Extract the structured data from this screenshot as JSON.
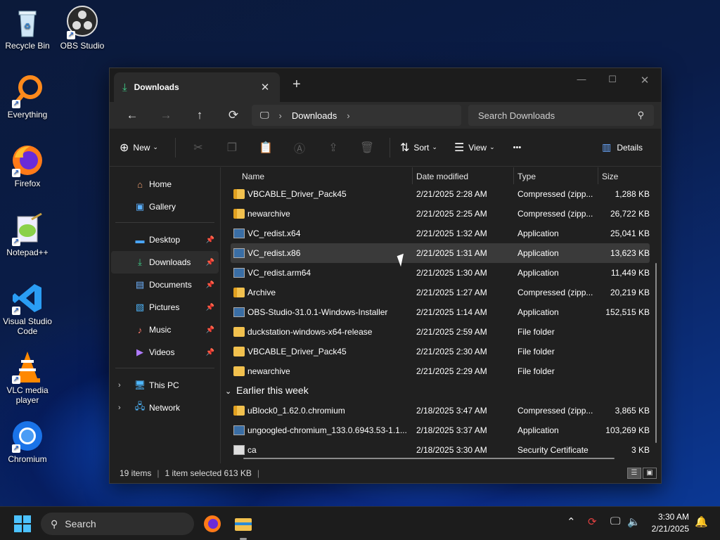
{
  "desktop": {
    "icons": [
      {
        "label": "Recycle Bin",
        "icon": "recycle-bin-icon"
      },
      {
        "label": "OBS Studio",
        "icon": "obs-icon"
      },
      {
        "label": "Everything",
        "icon": "everything-search-icon"
      },
      {
        "label": "Firefox",
        "icon": "firefox-icon"
      },
      {
        "label": "Notepad++",
        "icon": "notepad-plus-plus-icon"
      },
      {
        "label": "Visual Studio Code",
        "icon": "vscode-icon"
      },
      {
        "label": "VLC media player",
        "icon": "vlc-icon"
      },
      {
        "label": "Chromium",
        "icon": "chromium-icon"
      }
    ]
  },
  "window": {
    "tab_title": "Downloads",
    "tab_close": "✕",
    "new_tab": "+",
    "controls": {
      "minimize": "—",
      "maximize": "☐",
      "close": "✕"
    },
    "nav": {
      "back": "←",
      "forward": "→",
      "up": "↑",
      "refresh": "⟳"
    },
    "address": {
      "location": "Downloads",
      "sep": "›"
    },
    "search": {
      "placeholder": "Search Downloads"
    },
    "toolbar": {
      "new_label": "New",
      "sort_label": "Sort",
      "view_label": "View",
      "more": "•••",
      "details_label": "Details"
    },
    "sidebar": {
      "items": [
        {
          "label": "Home",
          "icon": "home-icon"
        },
        {
          "label": "Gallery",
          "icon": "gallery-icon"
        },
        {
          "label": "Desktop",
          "icon": "desktop-icon",
          "pinned": true
        },
        {
          "label": "Downloads",
          "icon": "downloads-icon",
          "pinned": true,
          "selected": true
        },
        {
          "label": "Documents",
          "icon": "documents-icon",
          "pinned": true
        },
        {
          "label": "Pictures",
          "icon": "pictures-icon",
          "pinned": true
        },
        {
          "label": "Music",
          "icon": "music-icon",
          "pinned": true
        },
        {
          "label": "Videos",
          "icon": "videos-icon",
          "pinned": true
        },
        {
          "label": "This PC",
          "icon": "this-pc-icon"
        },
        {
          "label": "Network",
          "icon": "network-icon"
        }
      ]
    },
    "columns": {
      "name": "Name",
      "date": "Date modified",
      "type": "Type",
      "size": "Size"
    },
    "files": [
      {
        "name": "VBCABLE_Driver_Pack45",
        "date": "2/21/2025 2:28 AM",
        "type": "Compressed (zipp...",
        "size": "1,288 KB",
        "kind": "zip"
      },
      {
        "name": "newarchive",
        "date": "2/21/2025 2:25 AM",
        "type": "Compressed (zipp...",
        "size": "26,722 KB",
        "kind": "zip"
      },
      {
        "name": "VC_redist.x64",
        "date": "2/21/2025 1:32 AM",
        "type": "Application",
        "size": "25,041 KB",
        "kind": "app"
      },
      {
        "name": "VC_redist.x86",
        "date": "2/21/2025 1:31 AM",
        "type": "Application",
        "size": "13,623 KB",
        "kind": "app",
        "selected": true
      },
      {
        "name": "VC_redist.arm64",
        "date": "2/21/2025 1:30 AM",
        "type": "Application",
        "size": "11,449 KB",
        "kind": "app"
      },
      {
        "name": "Archive",
        "date": "2/21/2025 1:27 AM",
        "type": "Compressed (zipp...",
        "size": "20,219 KB",
        "kind": "zip"
      },
      {
        "name": "OBS-Studio-31.0.1-Windows-Installer",
        "date": "2/21/2025 1:14 AM",
        "type": "Application",
        "size": "152,515 KB",
        "kind": "app"
      },
      {
        "name": "duckstation-windows-x64-release",
        "date": "2/21/2025 2:59 AM",
        "type": "File folder",
        "size": "",
        "kind": "folder"
      },
      {
        "name": "VBCABLE_Driver_Pack45",
        "date": "2/21/2025 2:30 AM",
        "type": "File folder",
        "size": "",
        "kind": "folder"
      },
      {
        "name": "newarchive",
        "date": "2/21/2025 2:29 AM",
        "type": "File folder",
        "size": "",
        "kind": "folder"
      }
    ],
    "group_earlier": "Earlier this week",
    "files_earlier": [
      {
        "name": "uBlock0_1.62.0.chromium",
        "date": "2/18/2025 3:47 AM",
        "type": "Compressed (zipp...",
        "size": "3,865 KB",
        "kind": "zip"
      },
      {
        "name": "ungoogled-chromium_133.0.6943.53-1.1...",
        "date": "2/18/2025 3:37 AM",
        "type": "Application",
        "size": "103,269 KB",
        "kind": "app"
      },
      {
        "name": "ca",
        "date": "2/18/2025 3:30 AM",
        "type": "Security Certificate",
        "size": "3 KB",
        "kind": "cert"
      }
    ],
    "status": {
      "count": "19 items",
      "selection": "1 item selected  613 KB",
      "sep": "|"
    }
  },
  "taskbar": {
    "search_label": "Search",
    "clock_time": "3:30 AM",
    "clock_date": "2/21/2025"
  }
}
